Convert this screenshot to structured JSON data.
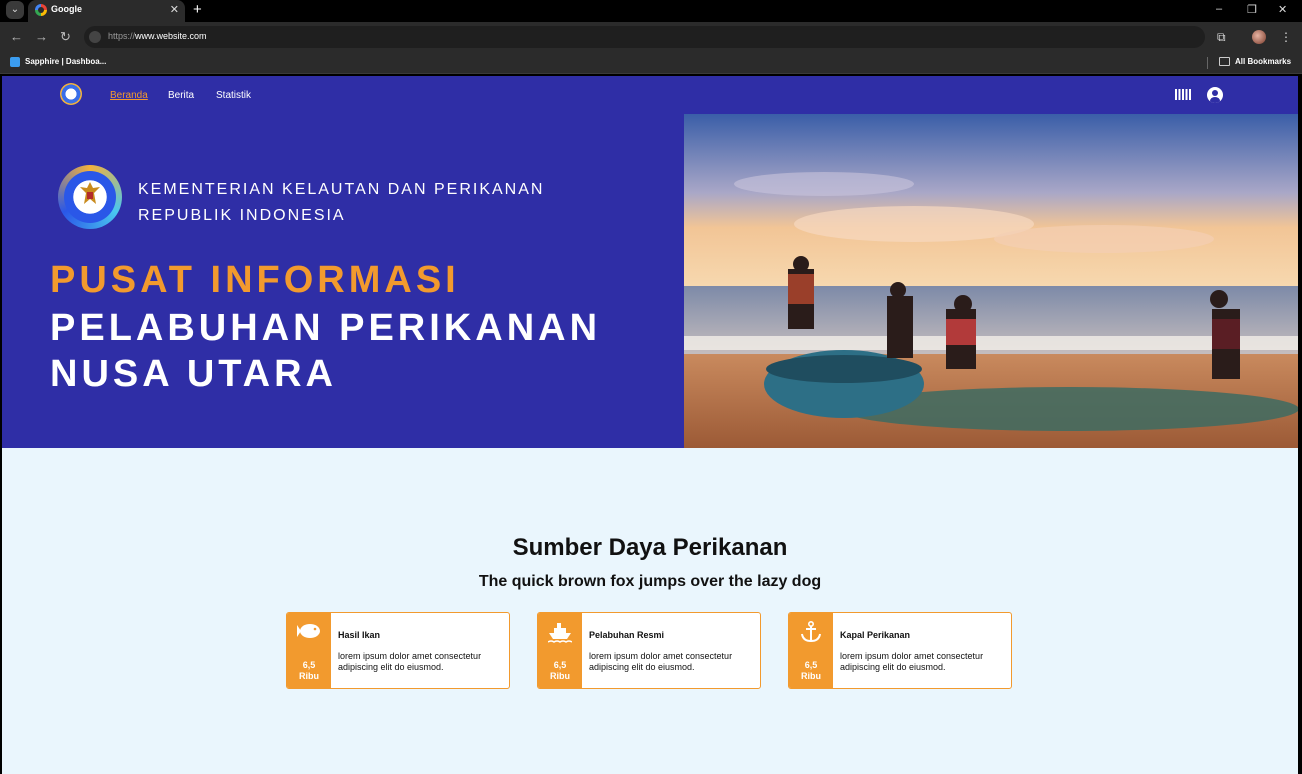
{
  "browser": {
    "tab_title": "Google",
    "tab_close": "✕",
    "new_tab": "+",
    "url_scheme": "https://",
    "url_host": "www.website.com",
    "bookmark_1": "Sapphire | Dashboa...",
    "all_bookmarks": "All Bookmarks",
    "icons": [
      "tab-menu-icon",
      "back-icon",
      "forward-icon",
      "reload-icon",
      "site-info-icon",
      "extensions-icon",
      "profile-icon",
      "kebab-menu-icon",
      "minimize-icon",
      "restore-icon",
      "close-window-icon"
    ]
  },
  "site": {
    "nav": [
      {
        "label": "Beranda",
        "active": true
      },
      {
        "label": "Berita",
        "active": false
      },
      {
        "label": "Statistik",
        "active": false
      }
    ],
    "header_icons": [
      "barcode-icon",
      "user-icon"
    ]
  },
  "hero": {
    "ministry_line_1": "KEMENTERIAN KELAUTAN DAN PERIKANAN",
    "ministry_line_2": "REPUBLIK INDONESIA",
    "headline_1": "PUSAT INFORMASI",
    "headline_2": "PELABUHAN PERIKANAN",
    "headline_3": "NUSA UTARA"
  },
  "section": {
    "title": "Sumber Daya Perikanan",
    "subtitle": "The quick brown fox jumps over the lazy dog",
    "cards": [
      {
        "icon": "fish-icon",
        "count": "6,5",
        "unit": "Ribu",
        "title": "Hasil Ikan",
        "desc": "lorem ipsum dolor amet consectetur adipiscing elit do eiusmod."
      },
      {
        "icon": "ship-icon",
        "count": "6,5",
        "unit": "Ribu",
        "title": "Pelabuhan Resmi",
        "desc": "lorem ipsum dolor amet consectetur adipiscing elit do eiusmod."
      },
      {
        "icon": "anchor-icon",
        "count": "6,5",
        "unit": "Ribu",
        "title": "Kapal Perikanan",
        "desc": "lorem ipsum dolor amet consectetur adipiscing elit do eiusmod."
      }
    ]
  },
  "colors": {
    "primary": "#2f2ea6",
    "accent": "#f29a2e",
    "background": "#eaf6fd"
  }
}
